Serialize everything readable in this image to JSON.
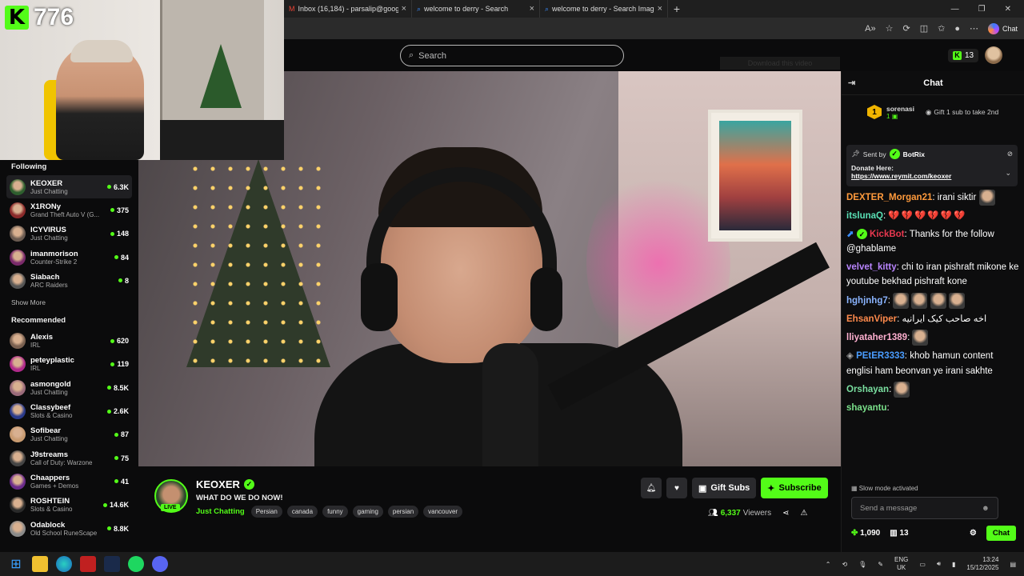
{
  "overlay": {
    "kick_letter": "K",
    "count": "776"
  },
  "browser": {
    "tabs": [
      {
        "title": "Inbox (16,184) - parsalip@google"
      },
      {
        "title": "welcome to derry - Search"
      },
      {
        "title": "welcome to derry - Search Image"
      }
    ],
    "copilot_label": "Chat"
  },
  "header": {
    "search_placeholder": "Search",
    "download_chip": "Download this video",
    "kicks_count": "13"
  },
  "sidebar": {
    "following_title": "Following",
    "following": [
      {
        "name": "KEOXER",
        "category": "Just Chatting",
        "viewers": "6.3K",
        "color": "#2e5f2e"
      },
      {
        "name": "X1RONy",
        "category": "Grand Theft Auto V (G...",
        "viewers": "375",
        "color": "#8a2a2a"
      },
      {
        "name": "ICYVIRUS",
        "category": "Just Chatting",
        "viewers": "148",
        "color": "#6a5a50"
      },
      {
        "name": "imanmorison",
        "category": "Counter-Strike 2",
        "viewers": "84",
        "color": "#7a2a6a"
      },
      {
        "name": "Siabach",
        "category": "ARC Raiders",
        "viewers": "8",
        "color": "#555555"
      }
    ],
    "show_more": "Show More",
    "recommended_title": "Recommended",
    "recommended": [
      {
        "name": "Alexis",
        "category": "IRL",
        "viewers": "620",
        "color": "#7a6050"
      },
      {
        "name": "peteyplastic",
        "category": "IRL",
        "viewers": "119",
        "color": "#b02a8a"
      },
      {
        "name": "asmongold",
        "category": "Just Chatting",
        "viewers": "8.5K",
        "color": "#9a6a7a"
      },
      {
        "name": "Classybeef",
        "category": "Slots & Casino",
        "viewers": "2.6K",
        "color": "#2a3a8a"
      },
      {
        "name": "Sofibear",
        "category": "Just Chatting",
        "viewers": "87",
        "color": "#c89a70"
      },
      {
        "name": "J9streams",
        "category": "Call of Duty: Warzone",
        "viewers": "75",
        "color": "#444444"
      },
      {
        "name": "Chaappers",
        "category": "Games + Demos",
        "viewers": "41",
        "color": "#6a2a8a"
      },
      {
        "name": "ROSHTEIN",
        "category": "Slots & Casino",
        "viewers": "14.6K",
        "color": "#2a2a2a"
      },
      {
        "name": "Odablock",
        "category": "Old School RuneScape",
        "viewers": "8.8K",
        "color": "#8a8a8a"
      }
    ]
  },
  "stream": {
    "name": "KEOXER",
    "live": "LIVE",
    "title": "WHAT DO WE DO NOW!",
    "category": "Just Chatting",
    "tags": [
      "Persian",
      "canada",
      "funny",
      "gaming",
      "persian",
      "vancouver"
    ],
    "gift_label": "Gift Subs",
    "subscribe_label": "Subscribe",
    "viewers": "6,337",
    "viewers_label": "Viewers"
  },
  "chat": {
    "title": "Chat",
    "leader_rank": "1",
    "leader_name": "sorenasi",
    "leader_subs": "1",
    "leader_hint": "Gift 1 sub to take 2nd",
    "pinned_sent_by": "Sent by",
    "pinned_author": "BotRix",
    "pinned_donate": "Donate Here:",
    "pinned_link": "https://www.reymit.com/keoxer",
    "messages": [
      {
        "user": "DEXTER_Morgan21",
        "color": "#ff9a3c",
        "text": "irani siktir"
      },
      {
        "user": "itslunaQ",
        "color": "#59e0b5",
        "text": "💔💔💔💔💔💔"
      },
      {
        "user": "KickBot",
        "color": "#e8384f",
        "text": "Thanks for the follow @ghablame"
      },
      {
        "user": "velvet_kitty",
        "color": "#b985ff",
        "text": "chi to iran pishraft mikone ke youtube bekhad pishraft kone"
      },
      {
        "user": "hghjnhg7",
        "color": "#8ab4ff",
        "text": ""
      },
      {
        "user": "EhsanViper",
        "color": "#ff8a4c",
        "text": "اخه صاحب کیک ایرانیه"
      },
      {
        "user": "lliyataher1389",
        "color": "#ffb0d0",
        "text": ""
      },
      {
        "user": "PEtER3333",
        "color": "#4a9dff",
        "text": "khob hamun content englisi ham beonvan ye irani sakhte"
      },
      {
        "user": "Orshayan",
        "color": "#7adfa0",
        "text": ""
      },
      {
        "user": "shayantu",
        "color": "#7ae08a",
        "text": ""
      }
    ],
    "slow_mode": "Slow mode activated",
    "input_placeholder": "Send a message",
    "points": "1,090",
    "gift_count": "13",
    "send_label": "Chat"
  },
  "taskbar": {
    "lang1": "ENG",
    "lang2": "UK",
    "time": "13:24",
    "date": "15/12/2025"
  },
  "colors": {
    "kick_green": "#53fc18",
    "bg": "#0b0b0c"
  }
}
